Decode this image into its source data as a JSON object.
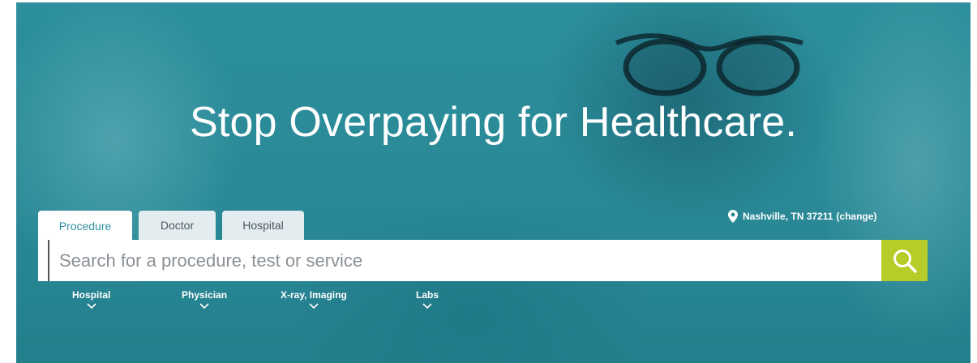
{
  "hero": {
    "title": "Stop Overpaying for Healthcare."
  },
  "location": {
    "icon": "map-pin-icon",
    "text": "Nashville, TN 37211",
    "change_label": "(change)"
  },
  "tabs": [
    {
      "label": "Procedure",
      "active": true
    },
    {
      "label": "Doctor",
      "active": false
    },
    {
      "label": "Hospital",
      "active": false
    }
  ],
  "search": {
    "placeholder": "Search for a procedure, test or service",
    "value": "",
    "button_icon": "search-icon"
  },
  "categories": [
    {
      "label": "Hospital",
      "icon": "chevron-down-icon"
    },
    {
      "label": "Physician",
      "icon": "chevron-down-icon"
    },
    {
      "label": "X-ray, Imaging",
      "icon": "chevron-down-icon"
    },
    {
      "label": "Labs",
      "icon": "chevron-down-icon"
    }
  ],
  "colors": {
    "hero_teal": "#2a8997",
    "accent_lime": "#b8cc29",
    "tab_active_text": "#2f8fa0",
    "tab_inactive_bg": "#e3ecef"
  }
}
